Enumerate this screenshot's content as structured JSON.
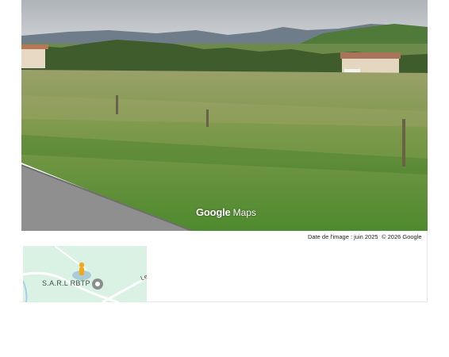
{
  "street_view": {
    "logo_google": "Google",
    "logo_maps": "Maps",
    "image_date": "Date de l'image : juin 2025",
    "copyright": "© 2026 Google"
  },
  "minimap": {
    "place_label": "S.A.R.L RBTP",
    "road_label": "Le"
  },
  "colors": {
    "sky": "#c9ced3",
    "grass": "#5c8a36",
    "road": "#8d8d8d",
    "map_bg": "#d9f2e4",
    "pegman": "#f2a81d"
  }
}
